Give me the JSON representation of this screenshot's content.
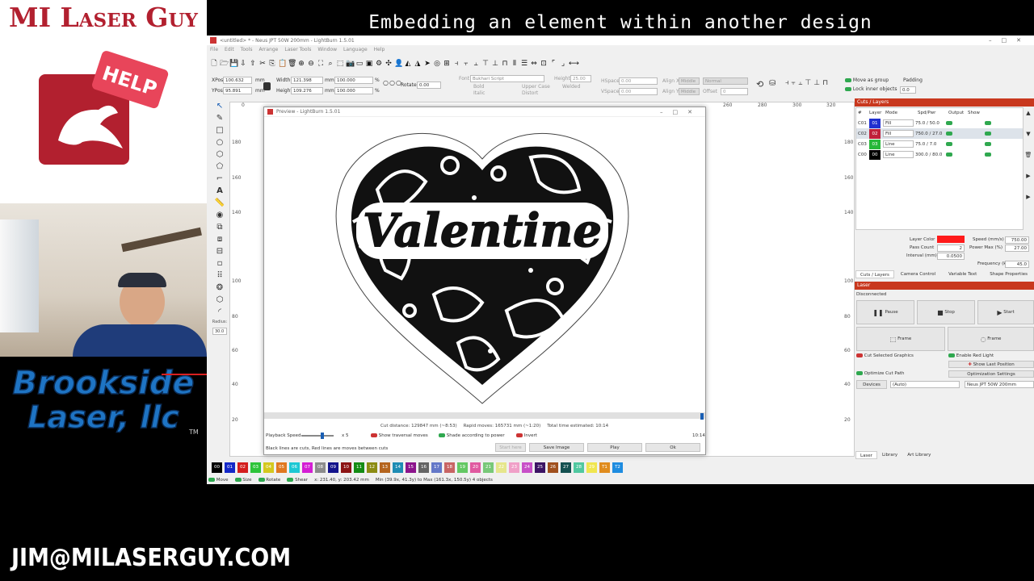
{
  "overlay": {
    "title": "Embedding an element within another design",
    "brand": "MI Laser Guy",
    "help_badge": "HELP",
    "company_line1": "Brookside",
    "company_line2": "Laser, llc",
    "tm": "TM",
    "email": "JIM@MILASERGUY.COM"
  },
  "app": {
    "window_title": "<untitled> * - Neus JPT 50W 200mm - LightBurn 1.5.01",
    "menu": [
      "File",
      "Edit",
      "Tools",
      "Arrange",
      "Laser Tools",
      "Window",
      "Language",
      "Help"
    ],
    "xpos_label": "XPos",
    "xpos": "100.632",
    "ypos_label": "YPos",
    "ypos": "95.891",
    "width_label": "Width",
    "width": "121.398",
    "height_label": "Height",
    "height": "109.276",
    "unit": "mm",
    "scale_w": "100.000",
    "scale_h": "100.000",
    "pct": "%",
    "rotate_label": "Rotate",
    "rotate": "0.00",
    "font_label": "Font",
    "font": "Bukhari Script",
    "font_height_label": "Height",
    "font_height": "25.00",
    "hspace_label": "HSpace",
    "hspace": "0.00",
    "vspace_label": "VSpace",
    "vspace": "0.00",
    "alignx_label": "Align X",
    "alignx": "Middle",
    "aligny_label": "Align Y",
    "aligny": "Middle",
    "normal": "Normal",
    "offset_label": "Offset",
    "offset": "0",
    "bold": "Bold",
    "italic": "Italic",
    "upper_case": "Upper Case",
    "welded": "Welded",
    "distort": "Distort",
    "move_group": "Move as group",
    "lock_inner": "Lock inner objects",
    "padding_label": "Padding",
    "padding": "0.0",
    "radius_label": "Radius:",
    "radius": "30.0",
    "ruler_top": [
      "0",
      "20",
      "40",
      "60",
      "80",
      "100",
      "120",
      "140",
      "160",
      "180",
      "200",
      "220",
      "240",
      "260",
      "280",
      "300",
      "320"
    ],
    "ruler_left": [
      "180",
      "160",
      "140",
      "100",
      "80",
      "60",
      "40",
      "20"
    ]
  },
  "preview": {
    "title": "Preview - LightBurn 1.5.01",
    "art_text": "Valentine",
    "cut_distance": "Cut distance: 129847 mm (~8:53)",
    "rapid_moves": "Rapid moves: 165731 mm (~1:20)",
    "total_time": "Total time estimated: 10:14",
    "playback_label": "Playback Speed",
    "playback_mult": "x 5",
    "show_traversal": "Show traversal moves",
    "shade_power": "Shade according to power",
    "invert": "Invert",
    "time_right": "10:14",
    "legend": "Black lines are cuts, Red lines are moves between cuts",
    "btn_start_here": "Start here",
    "btn_save_image": "Save Image",
    "btn_play": "Play",
    "btn_ok": "Ok"
  },
  "cuts": {
    "title": "Cuts / Layers",
    "headers": [
      "#",
      "Layer",
      "Mode",
      "Spd/Pwr",
      "Output",
      "Show"
    ],
    "rows": [
      {
        "num": "C01",
        "layer": "01",
        "color": "#2030d0",
        "mode": "Fill",
        "spdpwr": "75.0 / 50.0"
      },
      {
        "num": "C02",
        "layer": "02",
        "color": "#c0203a",
        "mode": "Fill",
        "spdpwr": "750.0 / 27.0"
      },
      {
        "num": "C03",
        "layer": "03",
        "color": "#27b83a",
        "mode": "Line",
        "spdpwr": "75.0 / 7.0"
      },
      {
        "num": "C00",
        "layer": "00",
        "color": "#000000",
        "mode": "Line",
        "spdpwr": "300.0 / 80.0"
      }
    ],
    "layer_color_label": "Layer Color",
    "layer_color": "#ff1a1a",
    "speed_label": "Speed (mm/s)",
    "speed": "750.00",
    "pass_label": "Pass Count",
    "pass": "2",
    "power_label": "Power Max (%)",
    "power": "27.00",
    "interval_label": "Interval (mm)",
    "interval": "0.0500",
    "freq_label": "Frequency (kHz)",
    "freq": "45.0",
    "tabs": [
      "Cuts / Layers",
      "Camera Control",
      "Variable Text",
      "Shape Properties"
    ]
  },
  "laser": {
    "title": "Laser",
    "status": "Disconnected",
    "pause": "Pause",
    "stop": "Stop",
    "start": "Start",
    "frame1": "Frame",
    "frame2": "Frame",
    "cut_selected": "Cut Selected Graphics",
    "enable_red": "Enable Red Light",
    "show_last": "Show Last Position",
    "optimize_path": "Optimize Cut Path",
    "opt_settings": "Optimization Settings",
    "devices": "Devices",
    "auto": "(Auto)",
    "device_name": "Neus JPT 50W 200mm",
    "tabs": [
      "Laser",
      "Library",
      "Art Library"
    ]
  },
  "palette": [
    {
      "l": "00",
      "c": "#000000"
    },
    {
      "l": "01",
      "c": "#1428c8"
    },
    {
      "l": "02",
      "c": "#d41e1e"
    },
    {
      "l": "03",
      "c": "#2ec43a"
    },
    {
      "l": "04",
      "c": "#d4c81e"
    },
    {
      "l": "05",
      "c": "#e07820"
    },
    {
      "l": "06",
      "c": "#1ec8d4"
    },
    {
      "l": "07",
      "c": "#d41ed4"
    },
    {
      "l": "08",
      "c": "#8c8c8c"
    },
    {
      "l": "09",
      "c": "#14148c"
    },
    {
      "l": "10",
      "c": "#8c1414"
    },
    {
      "l": "11",
      "c": "#148c14"
    },
    {
      "l": "12",
      "c": "#8c8c14"
    },
    {
      "l": "13",
      "c": "#b4641e"
    },
    {
      "l": "14",
      "c": "#1e8cb4"
    },
    {
      "l": "15",
      "c": "#8c148c"
    },
    {
      "l": "16",
      "c": "#646464"
    },
    {
      "l": "17",
      "c": "#6478c8"
    },
    {
      "l": "18",
      "c": "#c86464"
    },
    {
      "l": "19",
      "c": "#64c864"
    },
    {
      "l": "20",
      "c": "#e05aa0"
    },
    {
      "l": "21",
      "c": "#78c878"
    },
    {
      "l": "22",
      "c": "#e6e68c"
    },
    {
      "l": "23",
      "c": "#f0a0c8"
    },
    {
      "l": "24",
      "c": "#c850c8"
    },
    {
      "l": "25",
      "c": "#3c1464"
    },
    {
      "l": "26",
      "c": "#a0501e"
    },
    {
      "l": "27",
      "c": "#145050"
    },
    {
      "l": "28",
      "c": "#50c8a0"
    },
    {
      "l": "29",
      "c": "#f0e650"
    },
    {
      "l": "T1",
      "c": "#e08c1e"
    },
    {
      "l": "T2",
      "c": "#1e8ce0"
    }
  ],
  "status_bar": {
    "move": "Move",
    "size": "Size",
    "rotate": "Rotate",
    "shear": "Shear",
    "coords": "x: 231.40, y: 203.42 mm",
    "bounds": "Min (39.9x, 41.3y) to Max (161.3x, 150.5y)  4 objects"
  }
}
